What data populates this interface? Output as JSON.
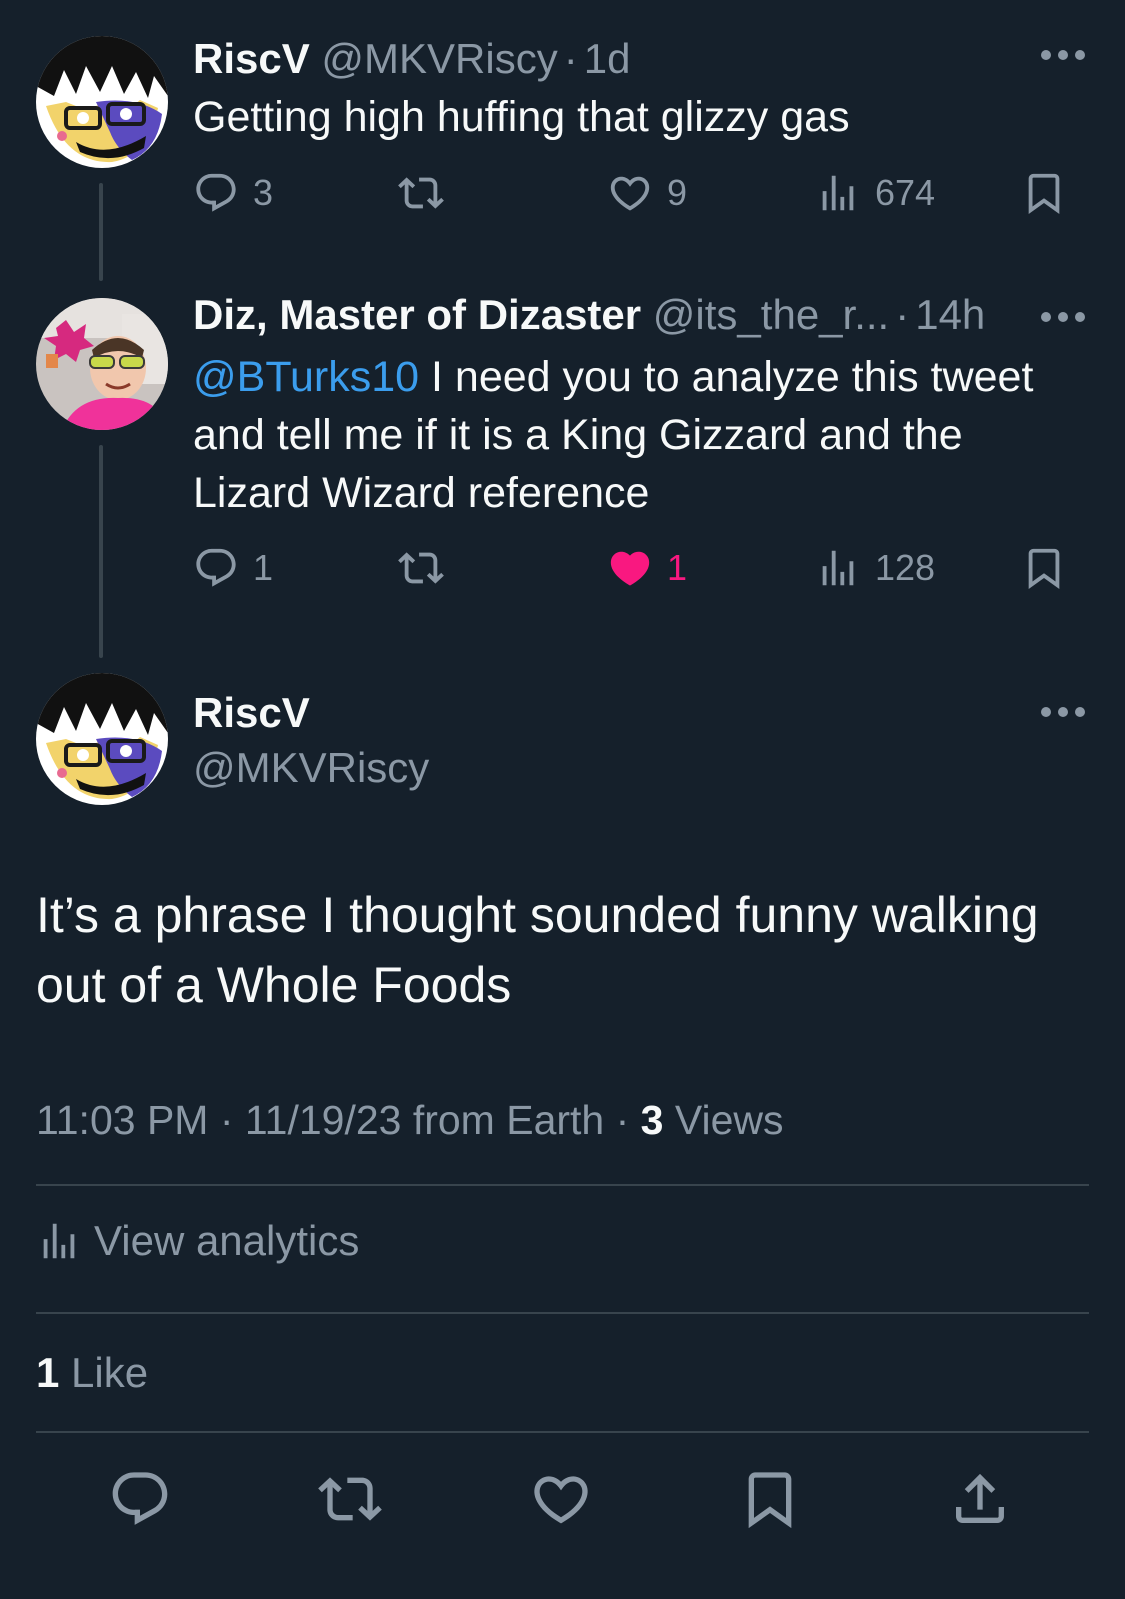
{
  "thread": [
    {
      "name": "RiscV",
      "handle": "@MKVRiscy",
      "sep": "·",
      "time": "1d",
      "text": "Getting high huffing that glizzy gas",
      "stats": {
        "replies": "3",
        "likes": "9",
        "views": "674"
      },
      "liked": false
    },
    {
      "name": "Diz, Master of Dizaster",
      "handle": "@its_the_r...",
      "sep": "·",
      "time": "14h",
      "mention": "@BTurks10",
      "text_lines": [
        " I need you to analyze this tweet",
        "and tell me if it is a King Gizzard and the",
        "Lizard Wizard reference"
      ],
      "stats": {
        "replies": "1",
        "likes": "1",
        "views": "128"
      },
      "liked": true
    }
  ],
  "main_tweet": {
    "name": "RiscV",
    "handle": "@MKVRiscy",
    "text_lines": [
      "It’s a phrase I thought sounded funny walking",
      "out of a Whole Foods"
    ],
    "meta": {
      "time": "11:03 PM",
      "sep1": " · ",
      "date_source": "11/19/23 from Earth",
      "sep2": " · ",
      "views_count": "3",
      "views_label": " Views"
    },
    "analytics_label": "View analytics",
    "likes_count": "1",
    "likes_label": " Like"
  },
  "colors": {
    "background": "#15202b",
    "text": "#f7f9f9",
    "muted": "#8b98a5",
    "link": "#3b9ded",
    "like_active": "#f91880",
    "divider": "#38444d"
  },
  "icons": [
    "reply-icon",
    "retweet-icon",
    "like-icon",
    "views-icon",
    "bookmark-icon",
    "share-icon",
    "more-icon"
  ]
}
